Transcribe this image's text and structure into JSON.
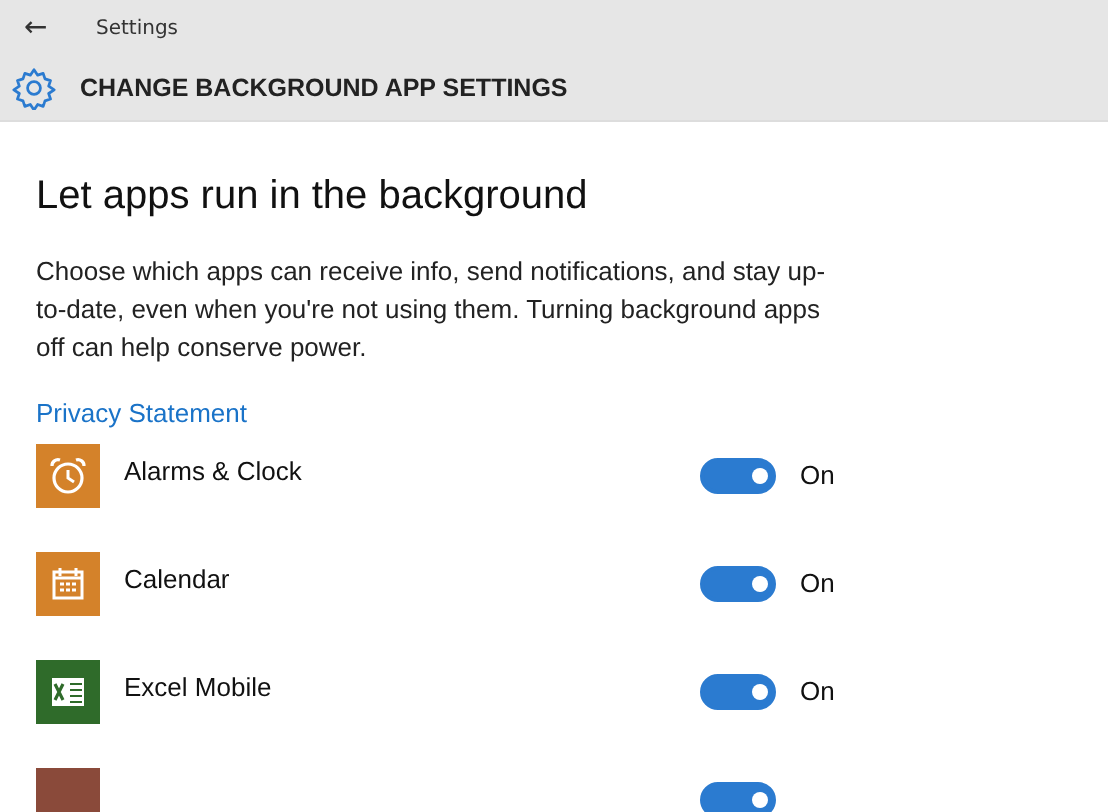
{
  "window": {
    "back": "←",
    "title": "Settings"
  },
  "header": {
    "title": "CHANGE BACKGROUND APP SETTINGS"
  },
  "heading": "Let apps run in the background",
  "description": "Choose which apps can receive info, send notifications, and stay up-to-date, even when you're not using them. Turning background apps off can help conserve power.",
  "privacy_link": "Privacy Statement",
  "apps": [
    {
      "name": "Alarms & Clock",
      "kind": "alarm",
      "color": "#d4822a",
      "on": true,
      "state_label": "On"
    },
    {
      "name": "Calendar",
      "kind": "calendar",
      "color": "#d4822a",
      "on": true,
      "state_label": "On"
    },
    {
      "name": "Excel Mobile",
      "kind": "excel",
      "color": "#2f6b2a",
      "on": true,
      "state_label": "On"
    },
    {
      "kind": "blank",
      "color": "#8a4a3a",
      "on": true
    }
  ]
}
